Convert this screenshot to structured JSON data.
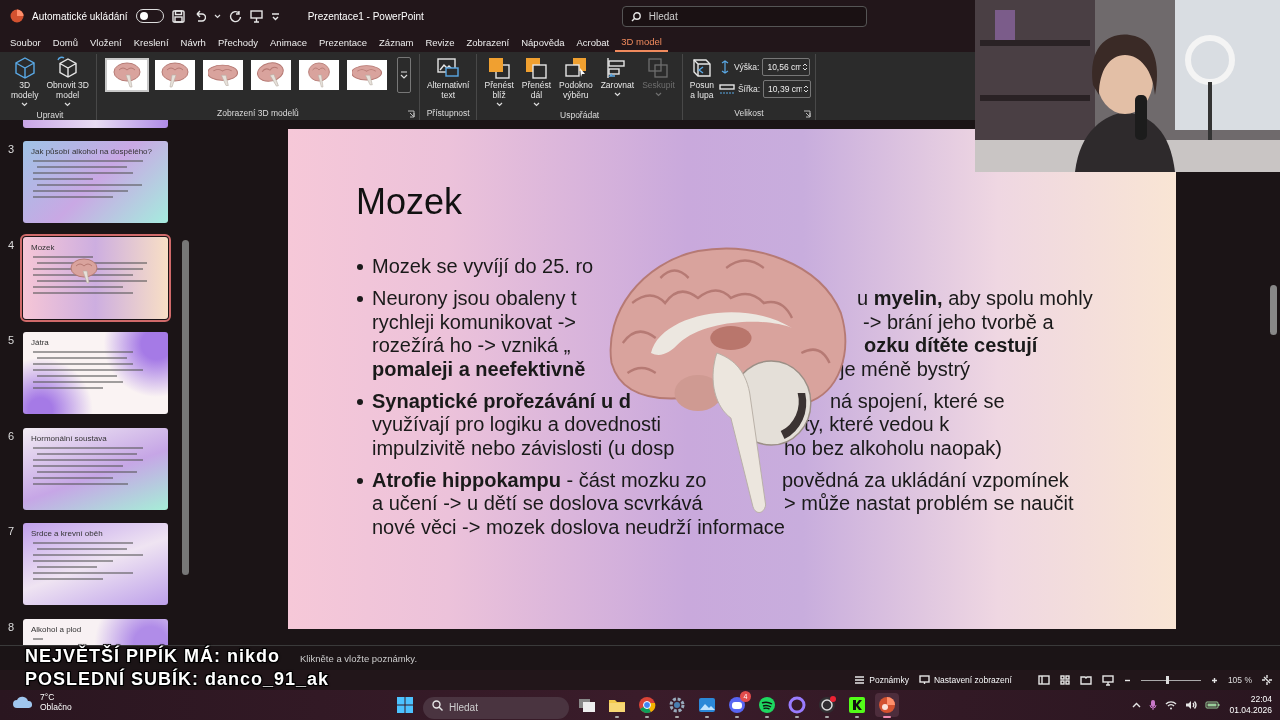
{
  "titlebar": {
    "autosave_label": "Automatické ukládání",
    "autosave_on": false,
    "title": "Prezentace1 - PowerPoint",
    "search_placeholder": "Hledat"
  },
  "menu_tabs": [
    {
      "label": "Soubor",
      "selected": false
    },
    {
      "label": "Domů",
      "selected": false
    },
    {
      "label": "Vložení",
      "selected": false
    },
    {
      "label": "Kreslení",
      "selected": false
    },
    {
      "label": "Návrh",
      "selected": false
    },
    {
      "label": "Přechody",
      "selected": false
    },
    {
      "label": "Animace",
      "selected": false
    },
    {
      "label": "Prezentace",
      "selected": false
    },
    {
      "label": "Záznam",
      "selected": false
    },
    {
      "label": "Revize",
      "selected": false
    },
    {
      "label": "Zobrazení",
      "selected": false
    },
    {
      "label": "Nápověda",
      "selected": false
    },
    {
      "label": "Acrobat",
      "selected": false
    },
    {
      "label": "3D model",
      "selected": true
    }
  ],
  "ribbon": [
    {
      "kind": "buttons",
      "label": "Upravit",
      "launcher": false,
      "buttons": [
        {
          "label": "3D\nmodely",
          "caret": true,
          "disabled": false
        },
        {
          "label": "Obnovit 3D\nmodel",
          "caret": true,
          "disabled": false
        }
      ]
    },
    {
      "kind": "gallery",
      "label": "Zobrazení 3D modelů",
      "launcher": true,
      "views": [
        {
          "selected": true
        },
        {
          "selected": false
        },
        {
          "selected": false
        },
        {
          "selected": false
        },
        {
          "selected": false
        },
        {
          "selected": false
        }
      ]
    },
    {
      "kind": "buttons",
      "label": "Přístupnost",
      "launcher": false,
      "buttons": [
        {
          "label": "Alternativní\ntext",
          "caret": false,
          "disabled": false
        }
      ]
    },
    {
      "kind": "buttons",
      "label": "Uspořádat",
      "launcher": false,
      "buttons": [
        {
          "label": "Přenést\nblíž",
          "caret": true,
          "disabled": false
        },
        {
          "label": "Přenést\ndál",
          "caret": true,
          "disabled": false
        },
        {
          "label": "Podokno\nvýběru",
          "caret": false,
          "disabled": false
        },
        {
          "label": "Zarovnat",
          "caret": true,
          "disabled": false
        },
        {
          "label": "Seskupit",
          "caret": true,
          "disabled": true
        }
      ]
    },
    {
      "kind": "fields",
      "label": "Velikost",
      "launcher": true,
      "buttons": [
        {
          "label": "Posun\na lupa",
          "caret": false,
          "disabled": false
        }
      ],
      "fields": [
        {
          "label": "Výška:",
          "value": "10,56 cm"
        },
        {
          "label": "Šířka:",
          "value": "10,39 cm"
        }
      ]
    }
  ],
  "thumbnails": [
    {
      "number": "3",
      "title": "Jak působí alkohol na dospělého?",
      "selected": false
    },
    {
      "number": "4",
      "title": "Mozek",
      "selected": true
    },
    {
      "number": "5",
      "title": "Játra",
      "selected": false
    },
    {
      "number": "6",
      "title": "Hormonální soustava",
      "selected": false
    },
    {
      "number": "7",
      "title": "Srdce a krevní oběh",
      "selected": false
    },
    {
      "number": "8",
      "title": "Alkohol a plod",
      "selected": false
    }
  ],
  "slide": {
    "title": "Mozek",
    "lines": [
      {
        "bullet": true,
        "left": "Mozek se vyvíjí do 25. ro",
        "left_bold": false
      },
      {
        "bullet": true,
        "left": "Neurony jsou obaleny t",
        "left_bold": false,
        "right": "u **myelin,** aby spolu mohly",
        "right_bold": false
      },
      {
        "bullet": false,
        "left": "rychleji komunikovat ->",
        "left_bold": false,
        "right": "-> brání jeho tvorbě a",
        "right_bold": false
      },
      {
        "bullet": false,
        "left": "rozežírá ho -> vzniká „",
        "left_bold": false,
        "right": "ozku dítěte cestují",
        "right_bold": true
      },
      {
        "bullet": false,
        "left": "pomaleji a neefektivně",
        "left_bold": true,
        "right": "je méně bystrý",
        "right_bold": false
      },
      {
        "bullet": true,
        "left": "Synaptické prořezávání u d",
        "left_bold": true,
        "right": "ná spojení, které se",
        "right_bold": false
      },
      {
        "bullet": false,
        "left": "využívají pro logiku a dovednosti",
        "left_bold": false,
        "right": "ty, které vedou k",
        "right_bold": false
      },
      {
        "bullet": false,
        "left": "impulzivitě nebo závislosti (u dosp",
        "left_bold": false,
        "right": "ho bez alkoholu naopak)",
        "right_bold": false
      },
      {
        "bullet": true,
        "left": "**Atrofie hippokampu** - část mozku zo",
        "left_bold": false,
        "right": "povědná za ukládání vzpomínek",
        "right_bold": false
      },
      {
        "bullet": false,
        "left": "a učení -> u dětí se doslova scvrkává",
        "left_bold": false,
        "right": "> může nastat problém se naučit",
        "right_bold": false
      },
      {
        "bullet": false,
        "left": "nové věci -> mozek doslova neudrží informace",
        "left_bold": false
      }
    ]
  },
  "notes": {
    "placeholder": "Klikněte a vložte poznámky."
  },
  "status_bar": {
    "notes": "Poznámky",
    "view_settings": "Nastavení zobrazení",
    "zoom": {
      "level": 0.45,
      "reading": "105 %"
    }
  },
  "stream_overlay": [
    "NEJVĚTŠÍ PIPÍK MÁ: nikdo",
    "POSLEDNÍ SUBÍK: danco_91_ak"
  ],
  "taskbar": {
    "weather": {
      "temperature": "7°C",
      "condition": "Oblačno"
    },
    "search_placeholder": "Hledat",
    "apps": [
      {
        "running": false,
        "active": false
      },
      {
        "running": true,
        "active": false
      },
      {
        "running": true,
        "active": false
      },
      {
        "running": true,
        "active": false
      },
      {
        "running": true,
        "active": false
      },
      {
        "running": true,
        "active": false,
        "badge": "4"
      },
      {
        "running": true,
        "active": false
      },
      {
        "running": true,
        "active": false
      },
      {
        "running": true,
        "active": false
      },
      {
        "running": true,
        "active": false
      },
      {
        "running": true,
        "active": true
      }
    ],
    "time": "22:04",
    "date": "01.04.2026"
  }
}
